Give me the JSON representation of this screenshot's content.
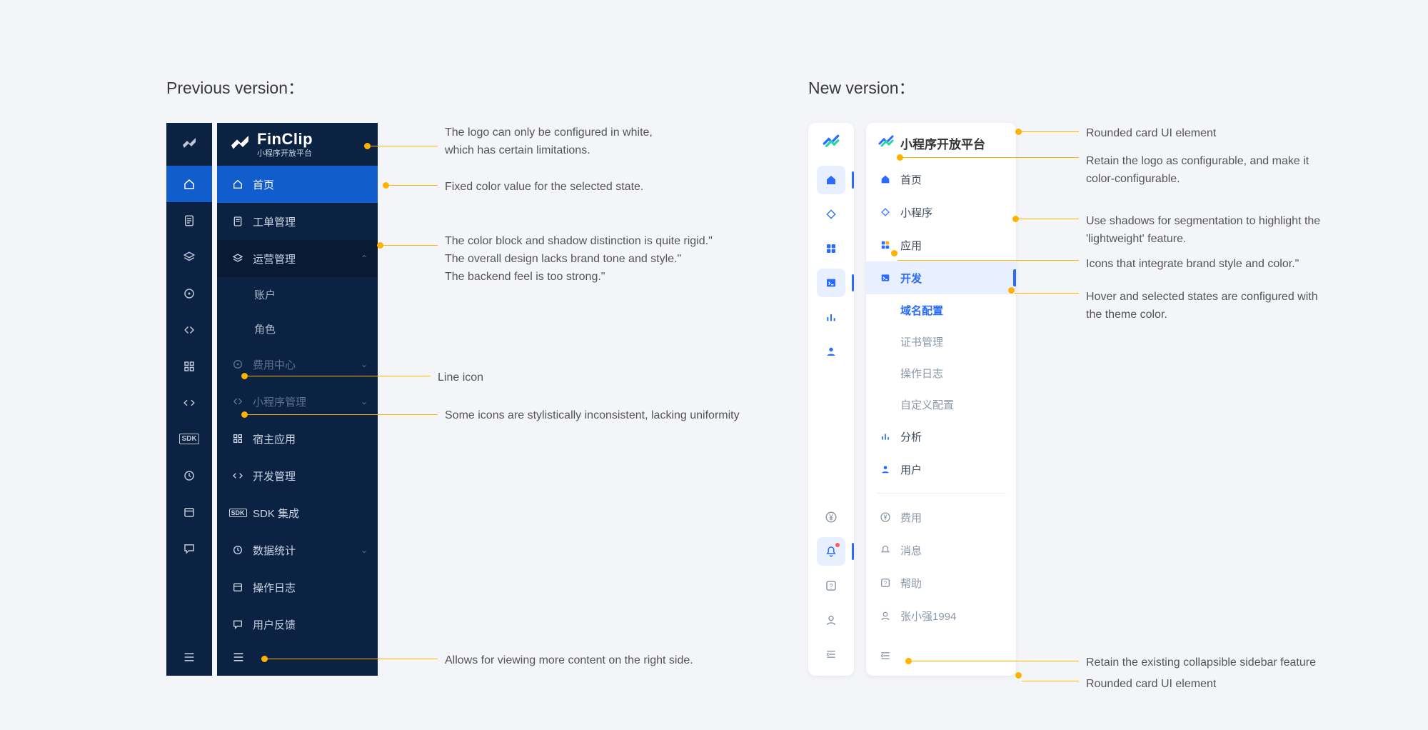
{
  "headings": {
    "previous": "Previous version：",
    "new": "New version："
  },
  "previous": {
    "brand_main": "FinClip",
    "brand_sub": "小程序开放平台",
    "items": [
      {
        "label": "首页"
      },
      {
        "label": "工单管理"
      },
      {
        "label": "运营管理"
      },
      {
        "label": "账户"
      },
      {
        "label": "角色"
      },
      {
        "label": "费用中心"
      },
      {
        "label": "小程序管理"
      },
      {
        "label": "宿主应用"
      },
      {
        "label": "开发管理"
      },
      {
        "label": "SDK 集成"
      },
      {
        "label": "数据统计"
      },
      {
        "label": "操作日志"
      },
      {
        "label": "用户反馈"
      }
    ],
    "annotations": {
      "logo": "The logo can only be configured in white,\nwhich has certain limitations.",
      "selected": "Fixed color value for the selected state.",
      "block": "The color block and shadow distinction is quite rigid.\"\nThe overall design lacks brand tone and style.\"\nThe backend feel is too strong.\"",
      "line_icon": "Line icon",
      "inconsistent": "Some icons are stylistically inconsistent, lacking uniformity",
      "collapse": "Allows for viewing more content on the right side."
    }
  },
  "new": {
    "brand": "小程序开放平台",
    "items": [
      {
        "label": "首页"
      },
      {
        "label": "小程序"
      },
      {
        "label": "应用"
      },
      {
        "label": "开发"
      },
      {
        "label": "域名配置"
      },
      {
        "label": "证书管理"
      },
      {
        "label": "操作日志"
      },
      {
        "label": "自定义配置"
      },
      {
        "label": "分析"
      },
      {
        "label": "用户"
      }
    ],
    "bottom_items": [
      {
        "label": "费用"
      },
      {
        "label": "消息"
      },
      {
        "label": "帮助"
      },
      {
        "label": "张小强1994"
      }
    ],
    "annotations": {
      "rounded_top": "Rounded card UI element",
      "logo_config": "Retain the logo as configurable, and make it\ncolor-configurable.",
      "shadow_seg": "Use shadows for segmentation to highlight the\n'lightweight' feature.",
      "icon_brand": "Icons that integrate brand style and color.\"",
      "hover": "Hover and selected states are configured with\nthe theme color.",
      "keep_collapse": "Retain the existing collapsible sidebar feature",
      "rounded_bottom": "Rounded card UI element"
    }
  }
}
